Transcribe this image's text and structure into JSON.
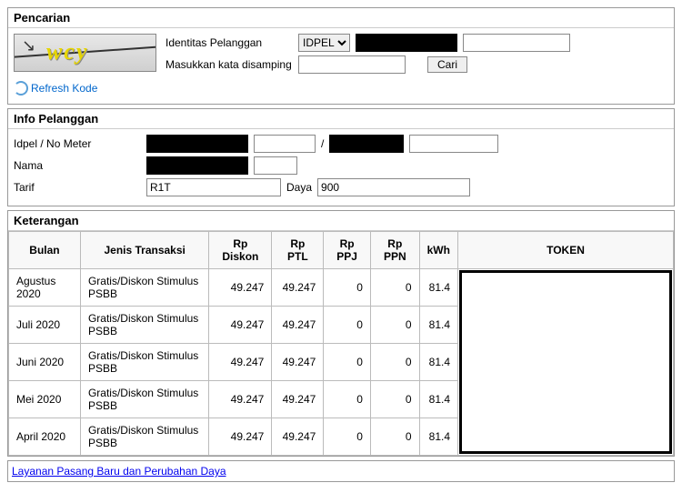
{
  "pencarian": {
    "title": "Pencarian",
    "captcha_text": "wcy",
    "label_identitas": "Identitas Pelanggan",
    "label_masukkan": "Masukkan kata disamping",
    "select_value": "IDPEL",
    "cari_label": "Cari",
    "refresh_label": "Refresh Kode"
  },
  "info": {
    "title": "Info Pelanggan",
    "label_idpel": "Idpel / No Meter",
    "label_nama": "Nama",
    "label_tarif": "Tarif",
    "tarif_value": "R1T",
    "label_daya": "Daya",
    "daya_value": "900"
  },
  "keterangan": {
    "title": "Keterangan",
    "headers": {
      "bulan": "Bulan",
      "jenis": "Jenis Transaksi",
      "diskon": "Rp Diskon",
      "ptl": "Rp PTL",
      "ppj": "Rp PPJ",
      "ppn": "Rp PPN",
      "kwh": "kWh",
      "token": "TOKEN"
    },
    "rows": [
      {
        "bulan": "Agustus 2020",
        "jenis": "Gratis/Diskon Stimulus PSBB",
        "diskon": "49.247",
        "ptl": "49.247",
        "ppj": "0",
        "ppn": "0",
        "kwh": "81.4"
      },
      {
        "bulan": "Juli 2020",
        "jenis": "Gratis/Diskon Stimulus PSBB",
        "diskon": "49.247",
        "ptl": "49.247",
        "ppj": "0",
        "ppn": "0",
        "kwh": "81.4"
      },
      {
        "bulan": "Juni 2020",
        "jenis": "Gratis/Diskon Stimulus PSBB",
        "diskon": "49.247",
        "ptl": "49.247",
        "ppj": "0",
        "ppn": "0",
        "kwh": "81.4"
      },
      {
        "bulan": "Mei 2020",
        "jenis": "Gratis/Diskon Stimulus PSBB",
        "diskon": "49.247",
        "ptl": "49.247",
        "ppj": "0",
        "ppn": "0",
        "kwh": "81.4"
      },
      {
        "bulan": "April 2020",
        "jenis": "Gratis/Diskon Stimulus PSBB",
        "diskon": "49.247",
        "ptl": "49.247",
        "ppj": "0",
        "ppn": "0",
        "kwh": "81.4"
      }
    ]
  },
  "footer_link": "Layanan Pasang Baru dan Perubahan Daya"
}
